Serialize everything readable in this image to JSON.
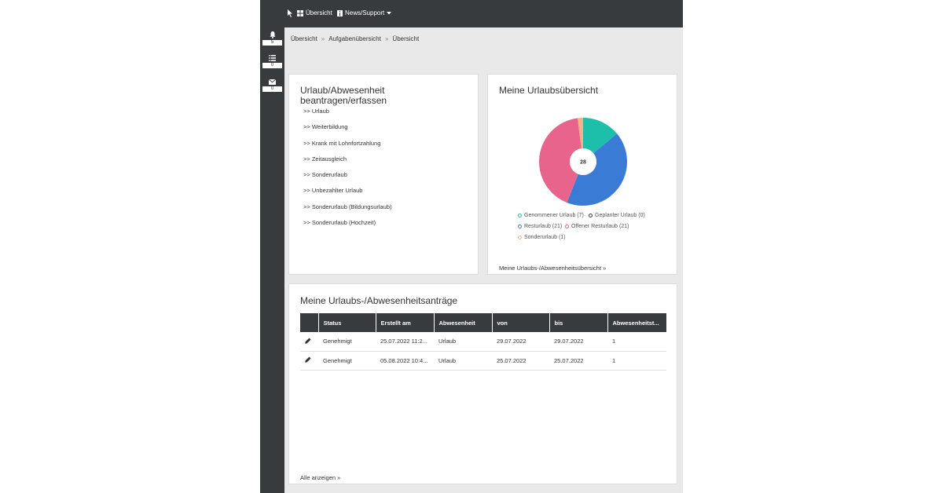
{
  "topbar": {
    "overview_label": "Übersicht",
    "news_label": "News/Support"
  },
  "sidebar": {
    "notifications_count": "5",
    "tasks_count": "0",
    "messages_count": "0"
  },
  "breadcrumb": [
    "Übersicht",
    "Aufgabenübersicht",
    "Übersicht"
  ],
  "request_card": {
    "title_line1": "Urlaub/Abwesenheit",
    "title_line2": "beantragen/erfassen",
    "links": [
      ">> Urlaub",
      ">> Weiterbildung",
      ">> Krank mit Lohnfortzahlung",
      ">> Zeitausgleich",
      ">> Sonderurlaub",
      ">> Unbezahlter Urlaub",
      ">> Sonderurlaub (Bildungsurlaub)",
      ">> Sonderurlaub (Hochzeit)"
    ]
  },
  "overview_card": {
    "title": "Meine Urlaubsübersicht",
    "center_total": "28",
    "footer_link": "Meine Urlaubs-/Abwesenheitsübersicht »"
  },
  "chart_data": {
    "type": "pie",
    "donut": true,
    "center_label": "28",
    "legend_position": "bottom",
    "series": [
      {
        "name": "Genommener Urlaub (7)",
        "value": 7,
        "color": "#1dbfab"
      },
      {
        "name": "Geplanter Urlaub (0)",
        "value": 0,
        "color": "#373b3e"
      },
      {
        "name": "Resturlaub (21)",
        "value": 21,
        "color": "#3a7bd5"
      },
      {
        "name": "Offener Resturlaub (21)",
        "value": 21,
        "color": "#e8648c"
      },
      {
        "name": "Sonderurlaub (1)",
        "value": 1,
        "color": "#f4b183"
      }
    ]
  },
  "requests_card": {
    "title": "Meine Urlaubs-/Abwesenheitsanträge",
    "columns": [
      "",
      "Status",
      "Erstellt am",
      "Abwesenheit",
      "von",
      "bis",
      "Abwesenheitst..."
    ],
    "rows": [
      {
        "status": "Genehmigt",
        "created": "25.07.2022 11:2...",
        "type": "Urlaub",
        "from": "29.07.2022",
        "to": "29.07.2022",
        "days": "1"
      },
      {
        "status": "Genehmigt",
        "created": "05.08.2022 10:4...",
        "type": "Urlaub",
        "from": "25.07.2022",
        "to": "25.07.2022",
        "days": "1"
      }
    ],
    "footer_link": "Alle anzeigen »"
  }
}
